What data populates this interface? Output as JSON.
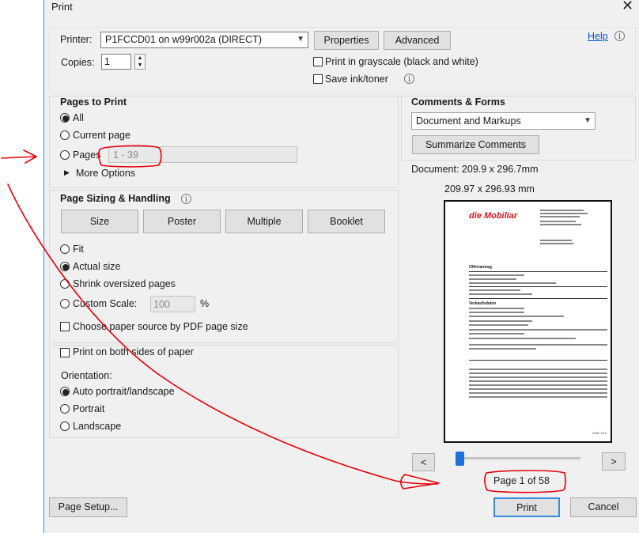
{
  "window": {
    "title": "Print",
    "close_glyph": "✕"
  },
  "printer": {
    "label": "Printer:",
    "value": "P1FCCD01 on w99r002a (DIRECT)",
    "properties_label": "Properties",
    "advanced_label": "Advanced",
    "help_label": "Help"
  },
  "copies": {
    "label": "Copies:",
    "value": "1"
  },
  "options": {
    "grayscale_label": "Print in grayscale (black and white)",
    "save_ink_label": "Save ink/toner"
  },
  "pages_to_print": {
    "heading": "Pages to Print",
    "all_label": "All",
    "current_label": "Current page",
    "pages_label": "Pages",
    "pages_value": "1 - 39",
    "more_options_label": "More Options",
    "selected": "All"
  },
  "sizing": {
    "heading": "Page Sizing & Handling",
    "tabs": [
      "Size",
      "Poster",
      "Multiple",
      "Booklet"
    ],
    "fit_label": "Fit",
    "actual_label": "Actual size",
    "shrink_label": "Shrink oversized pages",
    "custom_label": "Custom Scale:",
    "custom_value": "100",
    "custom_unit": "%",
    "paper_source_label": "Choose paper source by PDF page size",
    "selected": "Actual size"
  },
  "duplex": {
    "label": "Print on both sides of paper"
  },
  "orientation": {
    "heading": "Orientation:",
    "options": [
      "Auto portrait/landscape",
      "Portrait",
      "Landscape"
    ],
    "selected": "Auto portrait/landscape"
  },
  "comments": {
    "heading": "Comments & Forms",
    "value": "Document and Markups",
    "summarize_label": "Summarize Comments"
  },
  "document": {
    "size_label": "Document: 209.9 x 296.7mm",
    "paper_size": "209.97 x 296.93 mm",
    "preview": {
      "brand": "die Mobiliar",
      "heading1": "Offertantrag",
      "heading2": "Verkaufsdaten",
      "footer": "Seite 1/10"
    }
  },
  "pager": {
    "prev": "<",
    "next": ">",
    "page_label": "Page 1 of 58",
    "position": 0.0
  },
  "footer": {
    "page_setup_label": "Page Setup...",
    "print_label": "Print",
    "cancel_label": "Cancel"
  },
  "colors": {
    "annotation": "#e8000a",
    "link": "#0055cc",
    "window_border": "#3a8dd8",
    "slider": "#1a73d8"
  }
}
